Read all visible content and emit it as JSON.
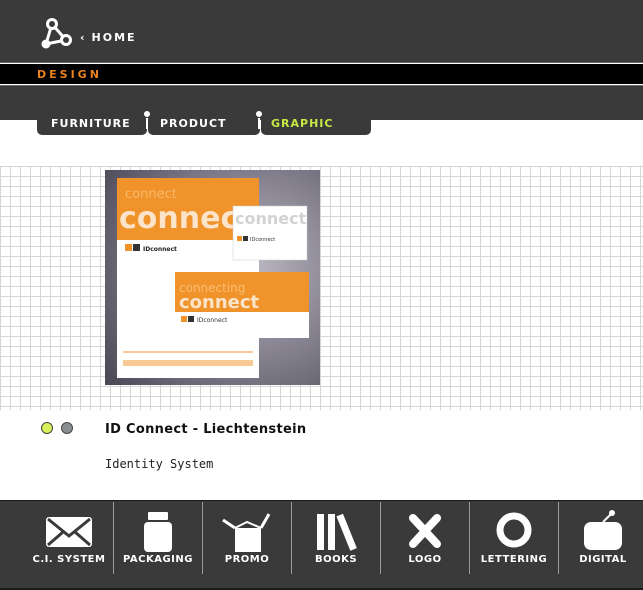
{
  "header": {
    "home_label": "HOME",
    "home_chevron": "‹",
    "logo_icon": "triangle-network-logo-icon"
  },
  "section": {
    "label": "DESIGN"
  },
  "tabs": [
    {
      "label": "FURNITURE",
      "active": false
    },
    {
      "label": "PRODUCT",
      "active": false
    },
    {
      "label": "GRAPHIC",
      "active": true
    }
  ],
  "preview": {
    "brand_text": "IDconnect",
    "big_text": "connect",
    "card_text": "connecting"
  },
  "project": {
    "title": "ID Connect - Liechtenstein",
    "subtitle": "Identity System"
  },
  "categories": [
    {
      "label": "C.I. SYSTEM",
      "icon": "envelope-icon"
    },
    {
      "label": "PACKAGING",
      "icon": "jar-icon"
    },
    {
      "label": "PROMO",
      "icon": "open-box-icon"
    },
    {
      "label": "BOOKS",
      "icon": "books-icon"
    },
    {
      "label": "LOGO",
      "icon": "x-mark-icon"
    },
    {
      "label": "LETTERING",
      "icon": "ring-icon"
    },
    {
      "label": "DIGITAL",
      "icon": "device-icon"
    }
  ],
  "colors": {
    "accent_orange": "#e8821c",
    "active_tab_green": "#c6e842",
    "dark_bar": "#3a3a3a"
  }
}
